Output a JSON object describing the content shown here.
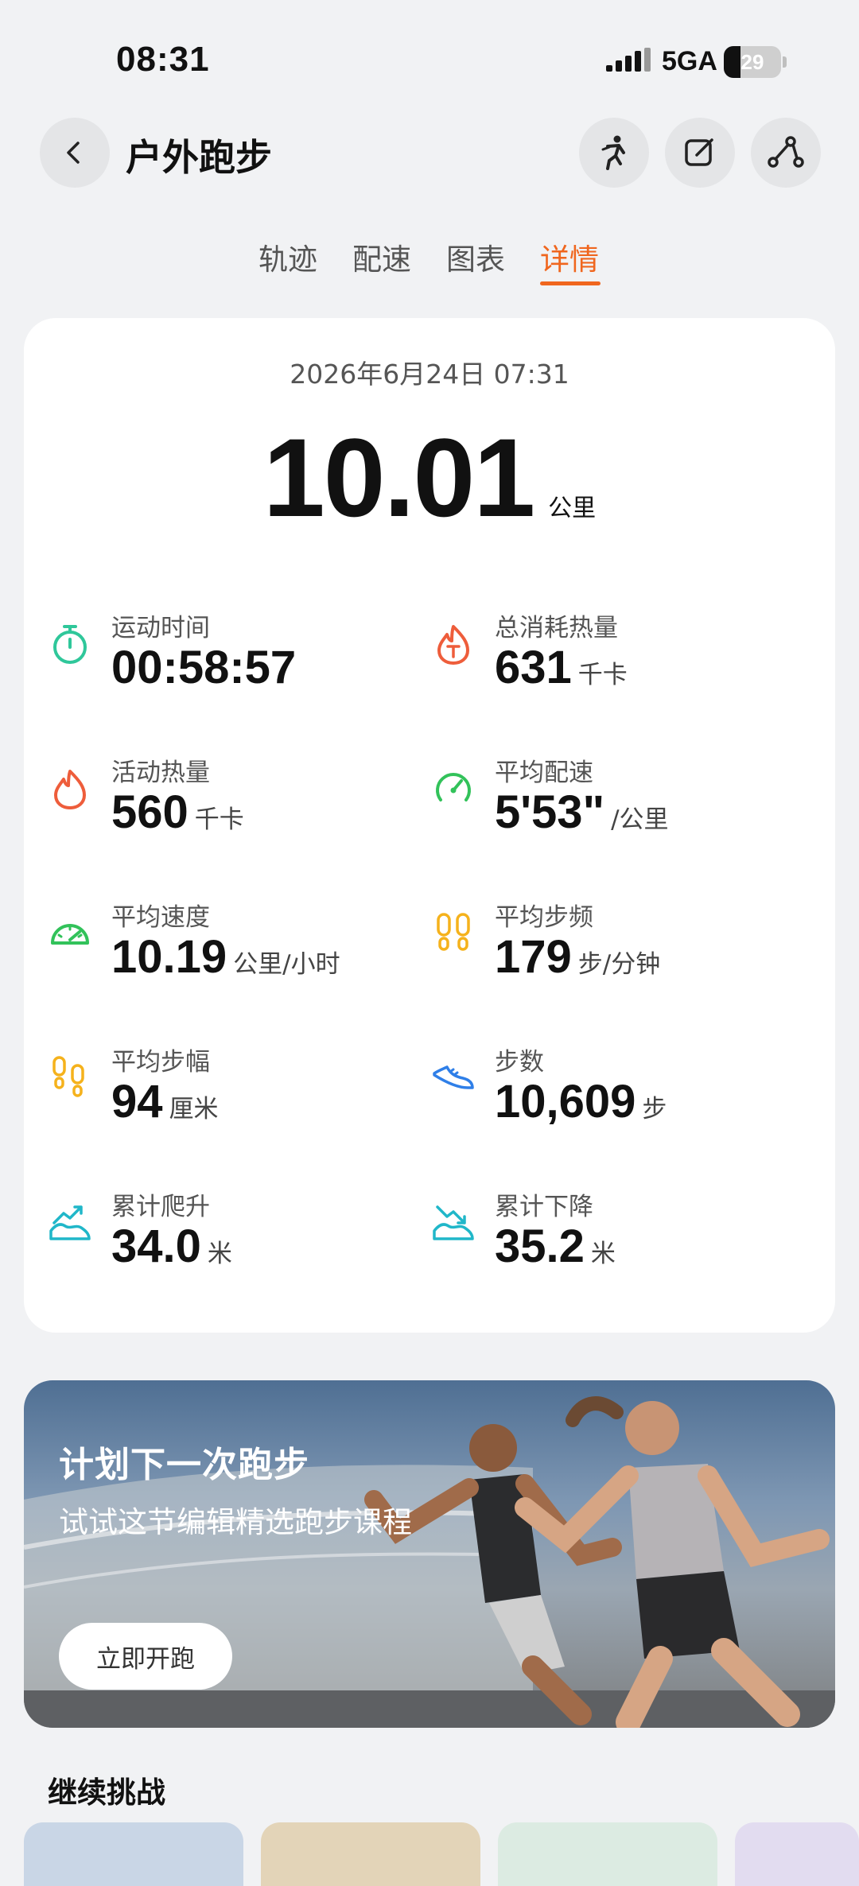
{
  "status_bar": {
    "time": "08:31",
    "network": "5GA",
    "battery_level": "29",
    "battery_fraction": 0.29
  },
  "header": {
    "title": "户外跑步",
    "icons": [
      "back-icon",
      "running-posture-icon",
      "edit-icon",
      "route-icon"
    ]
  },
  "tabs": [
    {
      "label": "轨迹",
      "active": false
    },
    {
      "label": "配速",
      "active": false
    },
    {
      "label": "图表",
      "active": false
    },
    {
      "label": "详情",
      "active": true
    }
  ],
  "summary": {
    "datetime": "2026年6月24日 07:31",
    "distance": "10.01",
    "distance_unit": "公里"
  },
  "metrics": [
    {
      "label": "运动时间",
      "value": "00:58:57",
      "unit": "",
      "icon": "stopwatch-icon",
      "color": "#2fc79a"
    },
    {
      "label": "总消耗热量",
      "value": "631",
      "unit": "千卡",
      "icon": "total-calorie-flame-icon",
      "color": "#ee5d3b"
    },
    {
      "label": "活动热量",
      "value": "560",
      "unit": "千卡",
      "icon": "flame-icon",
      "color": "#ee5d3b"
    },
    {
      "label": "平均配速",
      "value": "5'53\"",
      "unit": "/公里",
      "icon": "pace-gauge-icon",
      "color": "#32c25a"
    },
    {
      "label": "平均速度",
      "value": "10.19",
      "unit": "公里/小时",
      "icon": "speedometer-icon",
      "color": "#32c25a"
    },
    {
      "label": "平均步频",
      "value": "179",
      "unit": "步/分钟",
      "icon": "footprints-icon",
      "color": "#f5b21c"
    },
    {
      "label": "平均步幅",
      "value": "94",
      "unit": "厘米",
      "icon": "footsteps-icon",
      "color": "#f5b21c"
    },
    {
      "label": "步数",
      "value": "10,609",
      "unit": "步",
      "icon": "shoe-icon",
      "color": "#2f7fe8"
    },
    {
      "label": "累计爬升",
      "value": "34.0",
      "unit": "米",
      "icon": "ascent-icon",
      "color": "#20b7c9"
    },
    {
      "label": "累计下降",
      "value": "35.2",
      "unit": "米",
      "icon": "descent-icon",
      "color": "#20b7c9"
    }
  ],
  "banner": {
    "title": "计划下一次跑步",
    "subtitle": "试试这节编辑精选跑步课程",
    "button_label": "立即开跑"
  },
  "section": {
    "title": "继续挑战"
  },
  "colors": {
    "accent": "#f0661e",
    "background": "#f1f2f4",
    "card": "#ffffff"
  }
}
